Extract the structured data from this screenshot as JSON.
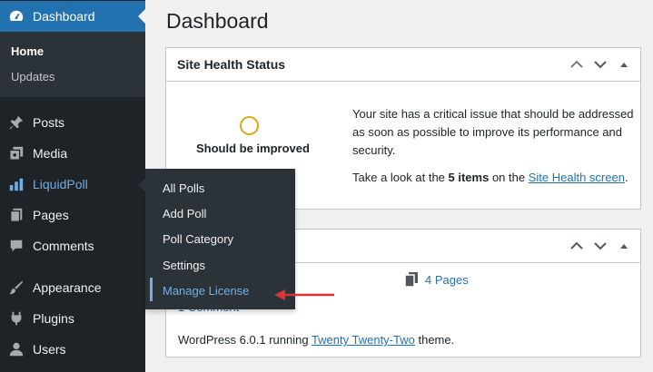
{
  "sidebar": {
    "dashboard": "Dashboard",
    "submenu": {
      "home": "Home",
      "updates": "Updates"
    },
    "items": [
      {
        "label": "Posts",
        "icon": "pin-icon"
      },
      {
        "label": "Media",
        "icon": "media-icon"
      },
      {
        "label": "LiquidPoll",
        "icon": "bar-chart-icon"
      },
      {
        "label": "Pages",
        "icon": "pages-icon"
      },
      {
        "label": "Comments",
        "icon": "comment-icon"
      },
      {
        "label": "Appearance",
        "icon": "brush-icon"
      },
      {
        "label": "Plugins",
        "icon": "plug-icon"
      },
      {
        "label": "Users",
        "icon": "user-icon"
      }
    ]
  },
  "flyout": {
    "items": [
      "All Polls",
      "Add Poll",
      "Poll Category",
      "Settings",
      "Manage License"
    ]
  },
  "main": {
    "title": "Dashboard",
    "site_health": {
      "title": "Site Health Status",
      "status": "Should be improved",
      "message": "Your site has a critical issue that should be addressed as soon as possible to improve its performance and security.",
      "take_prefix": "Take a look at the ",
      "items_count": "5 items",
      "take_middle": " on the ",
      "link": "Site Health screen",
      "take_suffix": "."
    },
    "at_a_glance": {
      "pages": "4 Pages",
      "comments": "1 Comment",
      "version_prefix": "WordPress 6.0.1 running ",
      "theme": "Twenty Twenty-Two",
      "version_suffix": " theme."
    }
  },
  "colors": {
    "sidebar_bg": "#1d2327",
    "active_bg": "#2271b1",
    "accent": "#72aee6",
    "warning_ring": "#dba617",
    "arrow": "#d63638"
  }
}
